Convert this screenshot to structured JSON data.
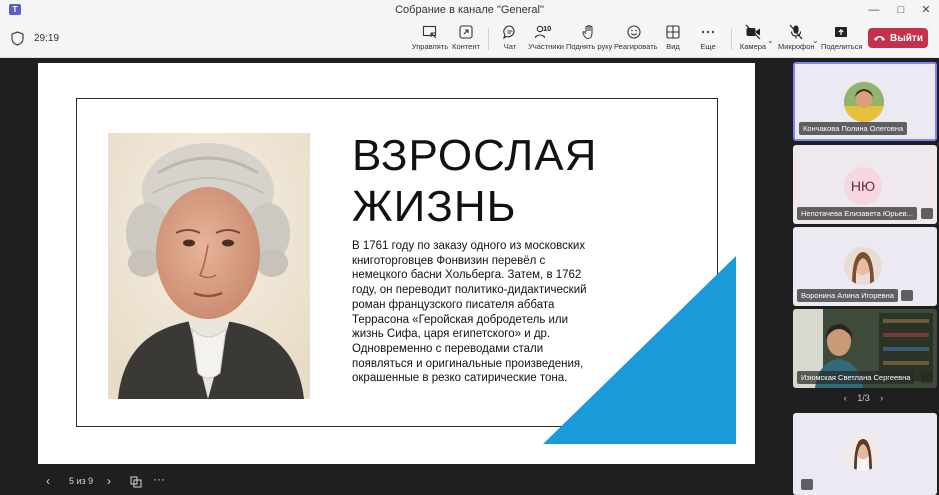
{
  "window": {
    "title": "Собрание в канале \"General\"",
    "controls": {
      "minimize": "—",
      "maximize": "□",
      "close": "✕"
    }
  },
  "toolbar": {
    "timer": "29:19",
    "buttons": {
      "control": "Управлять",
      "content": "Контент",
      "chat": "Чат",
      "participants": "Участники",
      "participants_count": "10",
      "raise_hand": "Поднять руку",
      "react": "Реагировать",
      "view": "Вид",
      "more": "Еще",
      "camera": "Камера",
      "mic": "Микрофон",
      "share": "Поделиться"
    },
    "leave": "Выйти",
    "icons": [
      "shield-icon",
      "control-icon",
      "content-icon",
      "chat-icon",
      "participants-icon",
      "raise-hand-icon",
      "react-icon",
      "view-icon",
      "more-icon",
      "camera-off-icon",
      "mic-off-icon",
      "share-icon",
      "phone-icon"
    ]
  },
  "slide": {
    "title_line1": "ВЗРОСЛАЯ",
    "title_line2": "ЖИЗНЬ",
    "body": "В 1761 году по заказу одного из московских книготорговцев Фонвизин перевёл с немецкого басни Хольберга. Затем, в 1762 году, он переводит политико-дидактический роман французского писателя аббата Террасона «Геройская добродетель или жизнь Сифа, царя египетского» и др. Одновременно с переводами стали появляться и оригинальные произведения, окрашенные в резко сатирические тона.",
    "accent_color": "#1a9ad9"
  },
  "slide_nav": {
    "prev": "‹",
    "page": "5 из 9",
    "next": "›",
    "more": "···"
  },
  "participants": {
    "tiles": [
      {
        "name": "Кончакова Полина Олеговна",
        "active": true
      },
      {
        "name": "Непотачева Елизавета Юрьев...",
        "initials": "НЮ",
        "muted": true
      },
      {
        "name": "Воронина Алина Игоревна",
        "muted": true
      },
      {
        "name": "Изюмская Светлана Сергеевна",
        "muted": true
      },
      {
        "name": "",
        "muted": true
      }
    ],
    "pager": {
      "prev": "‹",
      "label": "1/3",
      "next": "›"
    }
  }
}
